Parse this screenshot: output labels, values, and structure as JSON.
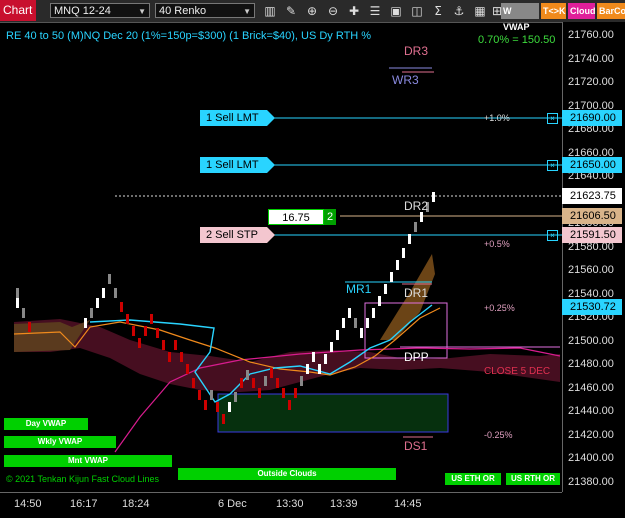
{
  "toolbar": {
    "chart_label": "Chart",
    "instrument": "MNQ 12-24",
    "bar_type": "40 Renko",
    "vwap_label": "W VWAP",
    "tk_label": "T<>K",
    "cloud_label": "Cloud",
    "barcolor_label": "BarCo",
    "icons": [
      "bar-chart-icon",
      "pencil-icon",
      "zoom-in-icon",
      "zoom-out-icon",
      "crosshair-icon",
      "properties-icon",
      "data-box-icon",
      "split-icon",
      "sigma-icon",
      "anchor-icon",
      "column-icon",
      "grid-icon"
    ]
  },
  "chart": {
    "title": "RE 40 to 50 (M)NQ Dec 20 (1%=150p=$300) (1 Brick=$40), US Dy RTH %",
    "pct_change": "0.70% = 150.50",
    "price_ticks": [
      "21760.00",
      "21740.00",
      "21720.00",
      "21700.00",
      "21680.00",
      "21660.00",
      "21640.00",
      "21620.00",
      "21600.00",
      "21580.00",
      "21560.00",
      "21540.00",
      "21520.00",
      "21500.00",
      "21480.00",
      "21460.00",
      "21440.00",
      "21420.00",
      "21400.00",
      "21380.00"
    ],
    "time_ticks": [
      "14:50",
      "16:17",
      "18:24",
      "6 Dec",
      "13:30",
      "13:39",
      "14:45"
    ],
    "pivots": {
      "dr3": "DR3",
      "wr3": "WR3",
      "dr2": "DR2",
      "mr1": "MR1",
      "dr1": "DR1",
      "dpp": "DPP",
      "ds1": "DS1",
      "close5": "CLOSE 5 DEC"
    },
    "pct_labels": {
      "p1": "+1.0%",
      "p05": "+0.5%",
      "p025": "+0.25%",
      "m025": "-0.25%"
    },
    "orders": [
      {
        "label": "1 Sell LMT",
        "price": "21690.00"
      },
      {
        "label": "1 Sell LMT",
        "price": "21650.00"
      },
      {
        "label": "2 Sell STP",
        "price": "21591.50"
      }
    ],
    "current_price": "21623.75",
    "avg_price": "21606.50",
    "cyan_price": "21530.72",
    "position_pnl": "16.75",
    "position_qty": "2",
    "buttons": {
      "day_vwap": "Day VWAP",
      "wkly_vwap": "Wkly VWAP",
      "mnt_vwap": "Mnt VWAP",
      "outside": "Outside Clouds",
      "eth": "US ETH OR",
      "rth": "US RTH OR"
    },
    "copyright": "© 2021 Tenkan Kijun Fast Cloud Lines",
    "colors": {
      "accent": "#29d4ff",
      "green": "#00d000",
      "sell_stp": "#f3c6cf",
      "avg": "#d9b48a"
    }
  }
}
